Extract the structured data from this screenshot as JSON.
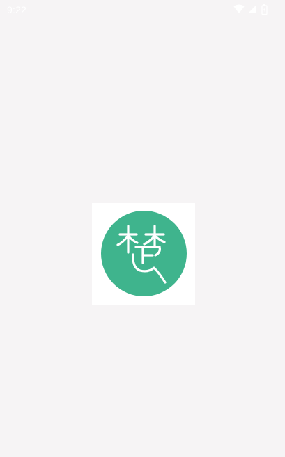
{
  "status_bar": {
    "time": "9:22",
    "icons": [
      "wifi-icon",
      "cellular-signal-icon",
      "battery-icon"
    ]
  },
  "splash": {
    "logo_icon": "chu-seal-logo-icon",
    "colors": {
      "background": "#f6f4f5",
      "card": "#ffffff",
      "logo_green": "#3fb48d"
    }
  }
}
